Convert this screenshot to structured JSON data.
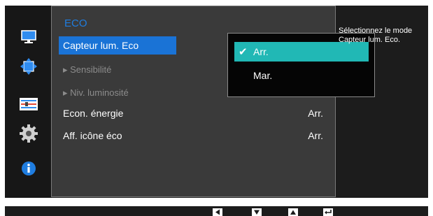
{
  "menu": {
    "title": "ECO",
    "items": [
      {
        "label": "Capteur lum. Eco",
        "value": ""
      },
      {
        "label": "▸ Sensibilité",
        "value": ""
      },
      {
        "label": "▸ Niv. luminosité",
        "value": ""
      },
      {
        "label": "Econ. énergie",
        "value": "Arr."
      },
      {
        "label": "Aff. icône éco",
        "value": "Arr."
      }
    ]
  },
  "dropdown": {
    "options": [
      {
        "label": "Arr.",
        "checked": true
      },
      {
        "label": "Mar.",
        "checked": false
      }
    ]
  },
  "help_text": "Sélectionnez le mode Capteur lum. Eco.",
  "sidebar": {
    "icons": [
      "monitor-icon",
      "size-position-icon",
      "setup-bars-icon",
      "gear-icon",
      "info-icon"
    ]
  },
  "colors": {
    "accent_blue": "#1a73d6",
    "title_blue": "#1f7de0",
    "dropdown_selected": "#21b8b5",
    "panel_bg": "#3a3a3a",
    "osd_bg": "#1c1c1c"
  },
  "bottom_keys": [
    "left-arrow-icon",
    "down-arrow-icon",
    "up-arrow-icon",
    "enter-icon"
  ]
}
